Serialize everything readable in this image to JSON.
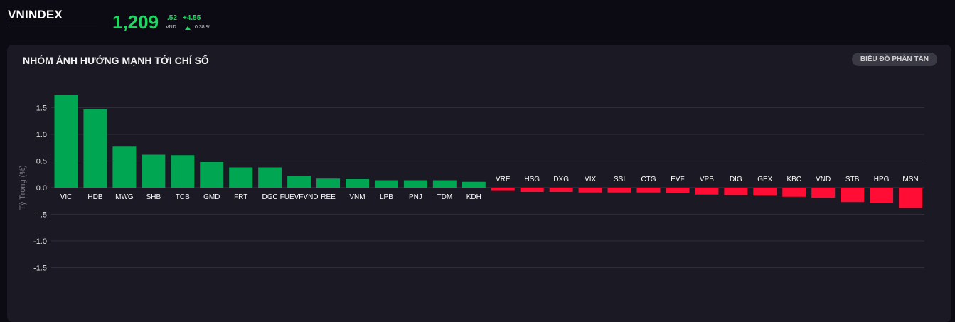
{
  "index": {
    "name": "VNINDEX",
    "value": "1,209",
    "decimal": ".52",
    "unit": "VND",
    "change": "+4.55",
    "change_pct": "0.38 %"
  },
  "panel": {
    "title": "NHÓM ẢNH HƯỞNG MẠNH TỚI CHỈ SỐ",
    "scatter_button": "BIỂU ĐỒ PHÂN TÁN"
  },
  "colors": {
    "positive": "#00a651",
    "negative": "#ff0d35",
    "accent": "#1ed760"
  },
  "chart_data": {
    "type": "bar",
    "ylabel": "Tỷ Trọng (%)",
    "ylim": [
      -1.75,
      1.75
    ],
    "yticks": [
      1.5,
      1.0,
      0.5,
      0.0,
      -0.5,
      -1.0,
      -1.5
    ],
    "ytick_labels": [
      "1.5",
      "1.0",
      "0.5",
      "0.0",
      "-.5",
      "-1.0",
      "-1.5"
    ],
    "grid": true,
    "categories": [
      "VIC",
      "HDB",
      "MWG",
      "SHB",
      "TCB",
      "GMD",
      "FRT",
      "DGC",
      "FUEVFVND",
      "REE",
      "VNM",
      "LPB",
      "PNJ",
      "TDM",
      "KDH",
      "VRE",
      "HSG",
      "DXG",
      "VIX",
      "SSI",
      "CTG",
      "EVF",
      "VPB",
      "DIG",
      "GEX",
      "KBC",
      "VND",
      "STB",
      "HPG",
      "MSN"
    ],
    "values": [
      1.74,
      1.47,
      0.77,
      0.62,
      0.61,
      0.48,
      0.38,
      0.38,
      0.22,
      0.17,
      0.16,
      0.14,
      0.14,
      0.14,
      0.11,
      -0.06,
      -0.08,
      -0.08,
      -0.09,
      -0.09,
      -0.09,
      -0.1,
      -0.13,
      -0.14,
      -0.15,
      -0.17,
      -0.19,
      -0.27,
      -0.29,
      -0.38
    ]
  }
}
